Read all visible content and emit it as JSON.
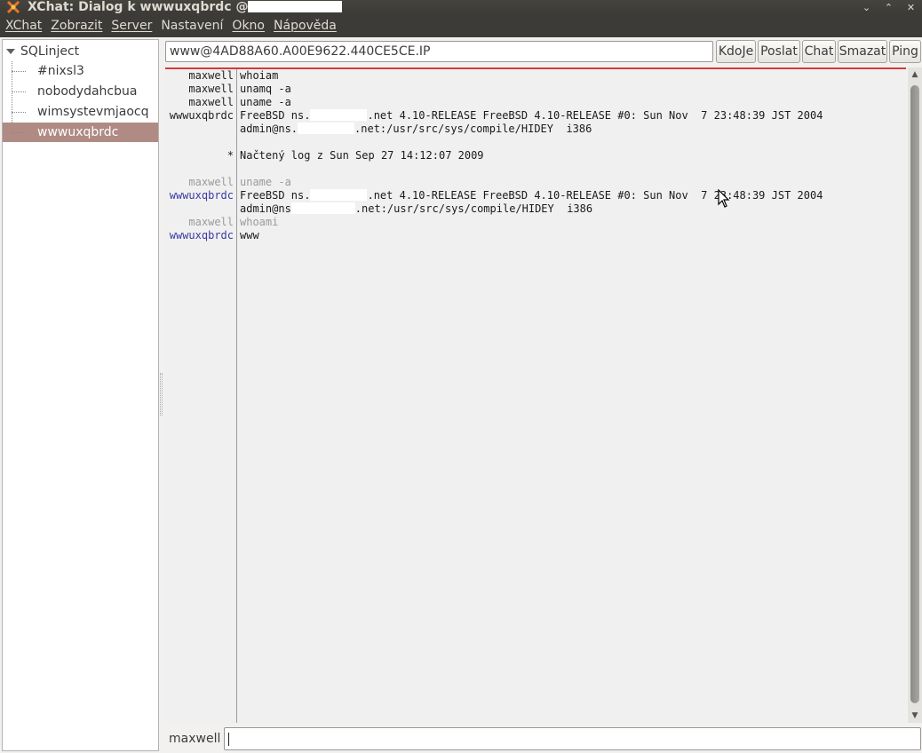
{
  "window": {
    "title": "XChat: Dialog k wwwuxqbrdc @",
    "controls": [
      "minimize",
      "maximize",
      "close"
    ]
  },
  "menubar": {
    "items": [
      {
        "accel": "X",
        "rest": "Chat"
      },
      {
        "accel": "Z",
        "rest": "obrazit"
      },
      {
        "accel": "S",
        "rest": "erver"
      },
      {
        "accel": "Nas",
        "rest": "tavení",
        "underline_index": 3
      },
      {
        "accel": "O",
        "rest": "kno"
      },
      {
        "accel": "N",
        "rest": "ápověda"
      }
    ]
  },
  "tree": {
    "root": "SQLinject",
    "children": [
      "#nixsl3",
      "nobodydahcbua",
      "wimsystevmjaocq",
      "wwwuxqbrdc"
    ],
    "selected": "wwwuxqbrdc"
  },
  "topic": {
    "value": "www@4AD88A60.A00E9622.440CE5CE.IP"
  },
  "buttons": {
    "whois": "KdoJe",
    "send": "Poslat",
    "chat": "Chat",
    "clear": "Smazat",
    "ping": "Ping"
  },
  "chat": {
    "lines": [
      {
        "nick": "maxwell",
        "msg": "whoiam",
        "style": "dark"
      },
      {
        "nick": "maxwell",
        "msg": "unamq -a",
        "style": "dark"
      },
      {
        "nick": "maxwell",
        "msg": "uname -a",
        "style": "dark"
      },
      {
        "nick": "wwwuxqbrdc",
        "msg_a": "FreeBSD ns.",
        "msg_b": ".net 4.10-RELEASE FreeBSD 4.10-RELEASE #0: Sun Nov  7 23:48:39 JST 2004",
        "style": "dark"
      },
      {
        "nick": "",
        "msg_a": "admin@ns.",
        "msg_b": ".net:/usr/src/sys/compile/HIDEY  i386",
        "style": "dark"
      },
      {
        "nick": "*",
        "msg": "Načtený log z Sun Sep 27 14:12:07 2009",
        "style": "dark"
      },
      {
        "nick": "maxwell",
        "msg": "uname -a",
        "style": "grey"
      },
      {
        "nick": "wwwuxqbrdc",
        "msg_a": "FreeBSD ns.",
        "msg_b": ".net 4.10-RELEASE FreeBSD 4.10-RELEASE #0: Sun Nov  7 23:48:39 JST 2004",
        "style": "blue"
      },
      {
        "nick": "",
        "msg_a": "admin@ns",
        "msg_b": ".net:/usr/src/sys/compile/HIDEY  i386",
        "style": "blue"
      },
      {
        "nick": "maxwell",
        "msg": "whoami",
        "style": "grey"
      },
      {
        "nick": "wwwuxqbrdc",
        "msg": "www",
        "style": "blue"
      }
    ]
  },
  "input": {
    "nick": "maxwell",
    "value": ""
  }
}
